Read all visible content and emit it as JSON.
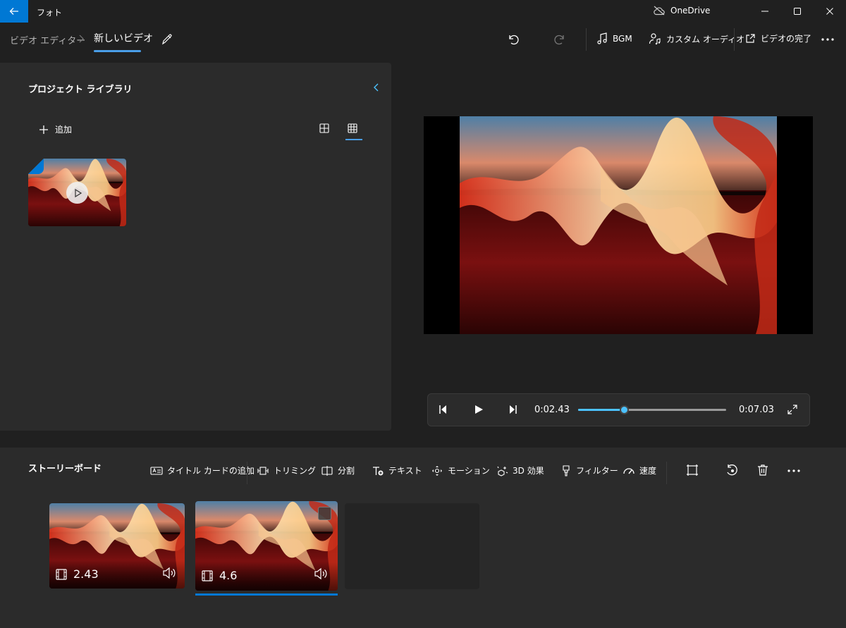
{
  "window": {
    "app_title": "フォト",
    "onedrive_label": "OneDrive"
  },
  "nav": {
    "breadcrumb_root": "ビデオ エディター",
    "breadcrumb_current": "新しいビデオ"
  },
  "toolbar": {
    "bgm_label": "BGM",
    "custom_audio_label": "カスタム オーディオ",
    "finish_video_label": "ビデオの完了"
  },
  "library": {
    "title": "プロジェクト ライブラリ",
    "add_label": "追加"
  },
  "player": {
    "current_time": "0:02.43",
    "total_time": "0:07.03",
    "progress": 0.31
  },
  "storyboard": {
    "title": "ストーリーボード",
    "tools": {
      "title_card": "タイトル カードの追加",
      "trim": "トリミング",
      "split": "分割",
      "text": "テキスト",
      "motion": "モーション",
      "effects_3d": "3D 効果",
      "filters": "フィルター",
      "speed": "速度"
    },
    "clips": [
      {
        "duration": "2.43"
      },
      {
        "duration": "4.6"
      }
    ]
  },
  "colors": {
    "accent": "#0078d4",
    "seek": "#4cc2ff",
    "background": "#202020",
    "panel": "#2b2b2b"
  },
  "icons": [
    "back-arrow-icon",
    "cloud-off-icon",
    "minimize-icon",
    "maximize-icon",
    "close-icon",
    "chevron-right-icon",
    "pencil-icon",
    "undo-icon",
    "redo-icon",
    "music-note-icon",
    "custom-audio-icon",
    "share-icon",
    "more-icon",
    "chevron-left-icon",
    "plus-icon",
    "grid-large-icon",
    "grid-small-icon",
    "play-icon",
    "skip-back-icon",
    "skip-forward-icon",
    "fullscreen-icon",
    "title-card-icon",
    "trim-icon",
    "split-icon",
    "text-icon",
    "motion-icon",
    "3d-effects-icon",
    "filter-icon",
    "speed-icon",
    "crop-icon",
    "rotate-icon",
    "delete-icon",
    "film-icon",
    "volume-icon"
  ]
}
